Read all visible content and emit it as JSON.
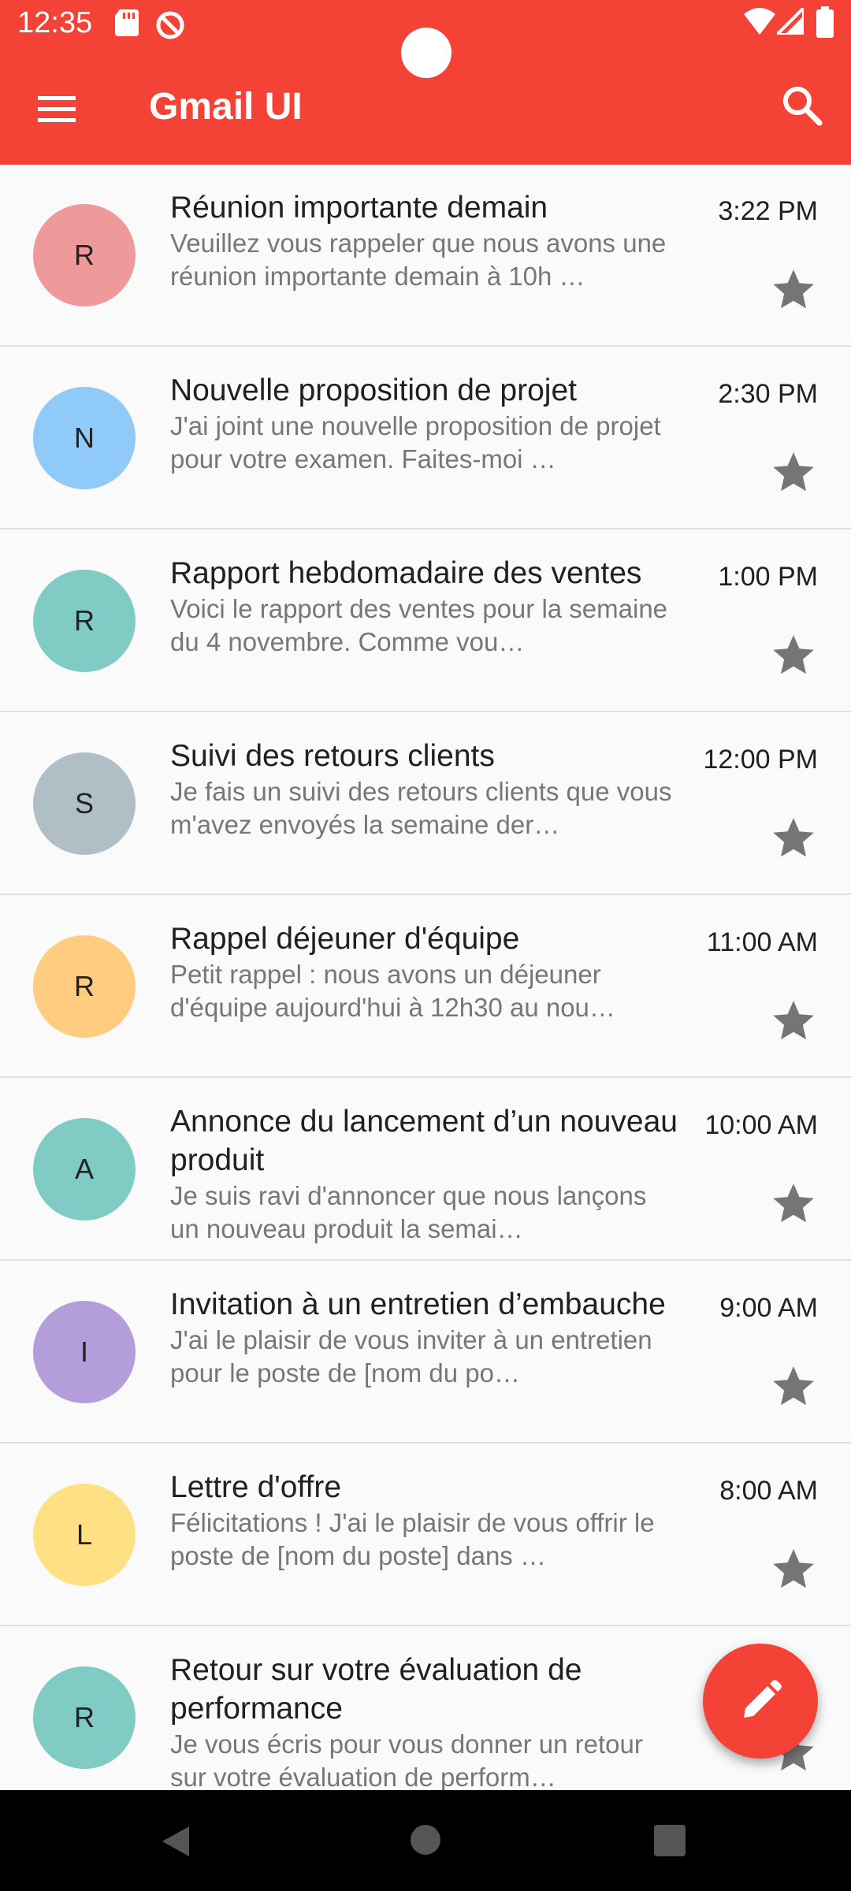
{
  "status_bar": {
    "time": "12:35"
  },
  "app_bar": {
    "title": "Gmail UI"
  },
  "icons": {
    "menu": "hamburger-menu-icon",
    "search": "search-icon",
    "star": "star-icon",
    "compose": "pencil-icon"
  },
  "colors": {
    "primary": "#f44336",
    "avatar_palette": [
      "#ef9a9a",
      "#90caf9",
      "#80cbc4",
      "#b0bec5",
      "#ffcc80",
      "#80cbc4",
      "#b39ddb",
      "#ffe082",
      "#80cbc4"
    ],
    "star": "#757575"
  },
  "emails": [
    {
      "initial": "R",
      "subject": "Réunion importante demain",
      "preview": "Veuillez vous rappeler que nous avons une réunion importante demain à 10h …",
      "time": "3:22 PM"
    },
    {
      "initial": "N",
      "subject": "Nouvelle proposition de projet",
      "preview": "J'ai joint une nouvelle proposition de projet pour votre examen. Faites-moi …",
      "time": "2:30 PM"
    },
    {
      "initial": "R",
      "subject": "Rapport hebdomadaire des ventes",
      "preview": "Voici le rapport des ventes pour la semaine du 4 novembre. Comme vou…",
      "time": "1:00 PM"
    },
    {
      "initial": "S",
      "subject": "Suivi des retours clients",
      "preview": "Je fais un suivi des retours clients que vous m'avez envoyés la semaine der…",
      "time": "12:00 PM"
    },
    {
      "initial": "R",
      "subject": "Rappel déjeuner d'équipe",
      "preview": "Petit rappel : nous avons un déjeuner d'équipe aujourd'hui à 12h30 au nou…",
      "time": "11:00 AM"
    },
    {
      "initial": "A",
      "subject": "Annonce du lancement d’un nouveau produit",
      "preview": "Je suis ravi d'annoncer que nous lançons un nouveau produit la semai…",
      "time": "10:00 AM"
    },
    {
      "initial": "I",
      "subject": "Invitation à un entretien d’embauche",
      "preview": "J'ai le plaisir de vous inviter à un entretien pour le poste de [nom du po…",
      "time": "9:00 AM"
    },
    {
      "initial": "L",
      "subject": "Lettre d'offre",
      "preview": "Félicitations ! J'ai le plaisir de vous offrir le poste de [nom du poste] dans …",
      "time": "8:00 AM"
    },
    {
      "initial": "R",
      "subject": "Retour sur votre évaluation de performance",
      "preview": "Je vous écris pour vous donner un retour sur votre évaluation de perform…",
      "time": ""
    }
  ]
}
